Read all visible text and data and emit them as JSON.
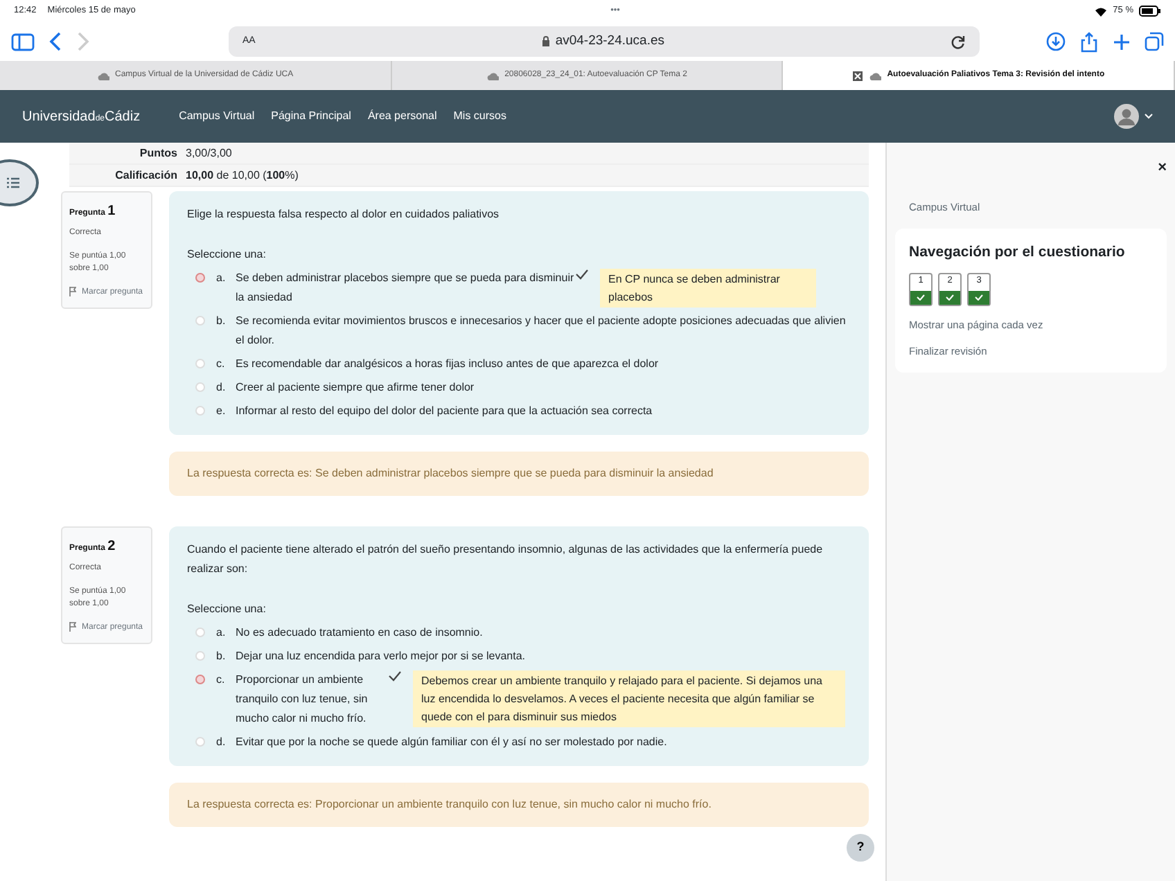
{
  "status_bar": {
    "time": "12:42",
    "date": "Miércoles 15 de mayo",
    "dots": "•••",
    "battery": "75 %"
  },
  "browser": {
    "reader": "AA",
    "address": "av04-23-24.uca.es",
    "tabs": [
      {
        "label": "Campus Virtual de la Universidad de Cádiz UCA",
        "selected": false
      },
      {
        "label": "20806028_23_24_01: Autoevaluación CP Tema 2",
        "selected": false
      },
      {
        "label": "Autoevaluación Paliativos Tema 3: Revisión del intento",
        "selected": true
      }
    ]
  },
  "navbar": {
    "brand": [
      "Universidad",
      "de",
      "Cádiz"
    ],
    "links": [
      "Campus Virtual",
      "Página Principal",
      "Área personal",
      "Mis cursos"
    ]
  },
  "summary": [
    {
      "label": "Puntos",
      "value": "3,00/3,00"
    },
    {
      "label": "Calificación",
      "value": "**10,00** de 10,00 (**100**%)"
    }
  ],
  "questions": [
    {
      "label": "Pregunta",
      "number": "1",
      "state": "Correcta",
      "score": "Se puntúa 1,00 sobre 1,00",
      "flag": "Marcar pregunta",
      "text": "Elige la respuesta falsa respecto al dolor en cuidados paliativos",
      "prompt": "Seleccione una:",
      "options": [
        {
          "letter": "a.",
          "text": "Se deben administrar placebos siempre que se pueda para disminuir la ansiedad",
          "selected": true,
          "feedback": "En CP nunca se deben administrar placebos"
        },
        {
          "letter": "b.",
          "text": "Se recomienda evitar movimientos bruscos e innecesarios y hacer que el paciente adopte posiciones adecuadas que alivien el dolor.",
          "selected": false
        },
        {
          "letter": "c.",
          "text": "Es recomendable dar analgésicos a horas fijas incluso antes de que aparezca el dolor",
          "selected": false
        },
        {
          "letter": "d.",
          "text": "Creer al paciente siempre que afirme tener dolor",
          "selected": false
        },
        {
          "letter": "e.",
          "text": "Informar al resto del equipo del dolor del paciente para que la actuación sea correcta",
          "selected": false
        }
      ],
      "right_answer": "La respuesta correcta es: Se deben administrar placebos siempre que se pueda para disminuir la ansiedad"
    },
    {
      "label": "Pregunta",
      "number": "2",
      "state": "Correcta",
      "score": "Se puntúa 1,00 sobre 1,00",
      "flag": "Marcar pregunta",
      "text": "Cuando el paciente tiene alterado el patrón del sueño presentando insomnio, algunas de las actividades que la enfermería puede realizar son:",
      "prompt": "Seleccione una:",
      "options": [
        {
          "letter": "a.",
          "text": "No es adecuado tratamiento en caso de insomnio.",
          "selected": false
        },
        {
          "letter": "b.",
          "text": "Dejar una luz encendida para verlo mejor por si se levanta.",
          "selected": false
        },
        {
          "letter": "c.",
          "text": "Proporcionar un ambiente tranquilo con luz tenue, sin mucho calor ni mucho frío.",
          "selected": true,
          "feedback": "Debemos crear un ambiente tranquilo y relajado para el paciente. Si dejamos una luz encendida lo desvelamos. A veces el paciente necesita que algún familiar se quede con el para disminuir sus miedos"
        },
        {
          "letter": "d.",
          "text": "Evitar que por la noche se quede algún familiar con él y así no ser molestado por nadie.",
          "selected": false
        }
      ],
      "right_answer": "La respuesta correcta es: Proporcionar un ambiente tranquilo con luz tenue, sin mucho calor ni mucho frío."
    }
  ],
  "drawer": {
    "close": "×",
    "breadcrumb": "Campus Virtual",
    "title": "Navegación por el cuestionario",
    "nav_buttons": [
      {
        "label": "1",
        "correct": true
      },
      {
        "label": "2",
        "correct": true
      },
      {
        "label": "3",
        "correct": true
      }
    ],
    "links": [
      "Mostrar una página cada vez",
      "Finalizar revisión"
    ]
  },
  "help": "?"
}
